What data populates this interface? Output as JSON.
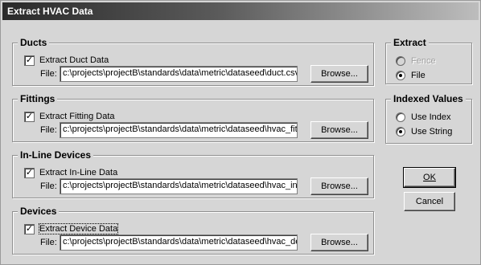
{
  "window": {
    "title": "Extract HVAC Data"
  },
  "file_label": "File:",
  "browse_label": "Browse...",
  "groups": {
    "ducts": {
      "title": "Ducts",
      "check_label": "Extract Duct Data",
      "checked": true,
      "file_path": "c:\\projects\\projectB\\standards\\data\\metric\\dataseed\\duct.csv"
    },
    "fittings": {
      "title": "Fittings",
      "check_label": "Extract Fitting Data",
      "checked": true,
      "file_path": "c:\\projects\\projectB\\standards\\data\\metric\\dataseed\\hvac_fit.("
    },
    "inline": {
      "title": "In-Line Devices",
      "check_label": "Extract In-Line Data",
      "checked": true,
      "file_path": "c:\\projects\\projectB\\standards\\data\\metric\\dataseed\\hvac_inl."
    },
    "devices": {
      "title": "Devices",
      "check_label": "Extract Device Data",
      "checked": true,
      "file_path": "c:\\projects\\projectB\\standards\\data\\metric\\dataseed\\hvac_de"
    }
  },
  "extract": {
    "title": "Extract",
    "options": [
      {
        "label": "Fence",
        "selected": false,
        "enabled": false
      },
      {
        "label": "File",
        "selected": true,
        "enabled": true
      }
    ]
  },
  "indexed_values": {
    "title": "Indexed Values",
    "options": [
      {
        "label": "Use Index",
        "selected": false,
        "enabled": true
      },
      {
        "label": "Use String",
        "selected": true,
        "enabled": true
      }
    ]
  },
  "buttons": {
    "ok": "OK",
    "cancel": "Cancel"
  },
  "checkmark": "✓"
}
